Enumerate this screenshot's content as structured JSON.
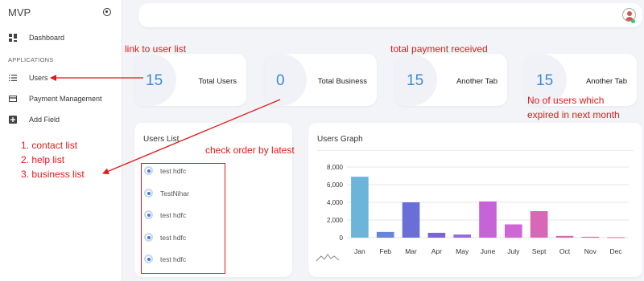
{
  "sidebar": {
    "brand": "MVP",
    "section_label": "APPLICATIONS",
    "items": [
      {
        "label": "Dashboard",
        "icon": "dashboard-icon"
      },
      {
        "label": "Users",
        "icon": "list-icon"
      },
      {
        "label": "Payment Management",
        "icon": "card-icon"
      },
      {
        "label": "Add Field",
        "icon": "plus-square-icon"
      }
    ]
  },
  "stats": [
    {
      "value": "15",
      "title": "Total Users"
    },
    {
      "value": "0",
      "title": "Total Business"
    },
    {
      "value": "15",
      "title": "Another Tab"
    },
    {
      "value": "15",
      "title": "Another Tab"
    }
  ],
  "users_list": {
    "title": "Users List",
    "items": [
      "test hdfc",
      "TestNihar",
      "test hdfc",
      "test hdfc",
      "test hdfc"
    ]
  },
  "users_graph": {
    "title": "Users Graph"
  },
  "chart_data": {
    "type": "bar",
    "categories": [
      "Jan",
      "Feb",
      "Mar",
      "Apr",
      "May",
      "June",
      "July",
      "Sept",
      "Oct",
      "Nov",
      "Dec"
    ],
    "values": [
      6900,
      650,
      4000,
      550,
      350,
      4100,
      1500,
      3000,
      200,
      100,
      50
    ],
    "colors": [
      "#6bb5da",
      "#6786d8",
      "#6a6fd8",
      "#7a64d6",
      "#9a66d8",
      "#c763d8",
      "#cf66d6",
      "#d967b8",
      "#d46aa6",
      "#cf6a9a",
      "#d8708f"
    ],
    "ylim": [
      0,
      8000
    ],
    "yticks": [
      "0",
      "2,000",
      "4,000",
      "6,000",
      "8,000"
    ],
    "grid": true
  },
  "annotations": {
    "link_users": "link to user list",
    "total_payment": "total payment received",
    "expired": [
      "No of users which",
      "expired in next month"
    ],
    "lists": [
      "1. contact list",
      "2. help list",
      "3. business list"
    ],
    "check_order": "check order by latest"
  },
  "colors": {
    "accent": "#3d8ad4",
    "annotation": "#e01a1a"
  }
}
